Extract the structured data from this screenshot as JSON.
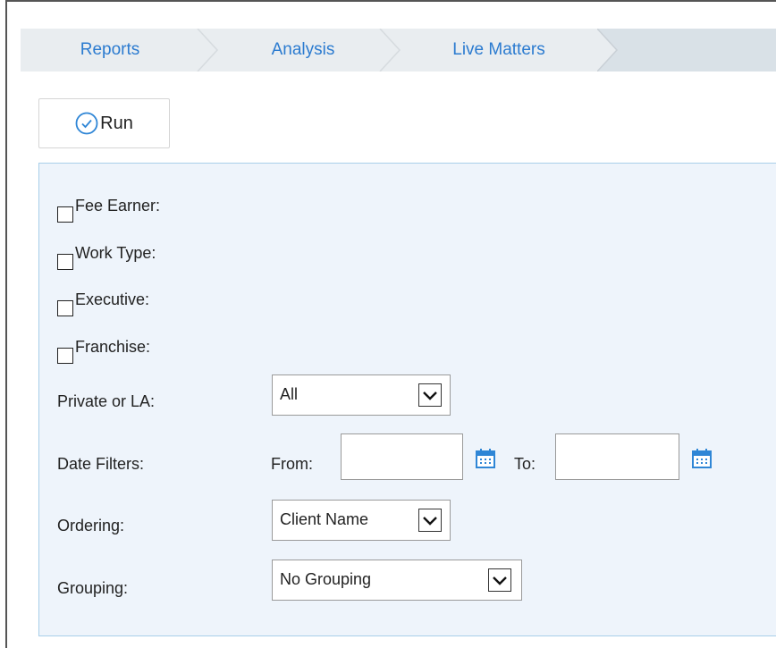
{
  "breadcrumb": {
    "items": [
      {
        "label": "Reports"
      },
      {
        "label": "Analysis"
      },
      {
        "label": "Live Matters"
      }
    ]
  },
  "toolbar": {
    "run_label": "Run",
    "run_icon": "check-circle-icon"
  },
  "filters": {
    "checkboxes": [
      {
        "label": "Fee Earner:",
        "checked": false
      },
      {
        "label": "Work Type:",
        "checked": false
      },
      {
        "label": "Executive:",
        "checked": false
      },
      {
        "label": "Franchise:",
        "checked": false
      }
    ],
    "private_or_la": {
      "label": "Private or LA:",
      "value": "All"
    },
    "date_filters": {
      "label": "Date Filters:",
      "from_label": "From:",
      "from_value": "",
      "to_label": "To:",
      "to_value": "",
      "calendar_icon": "calendar-icon"
    },
    "ordering": {
      "label": "Ordering:",
      "value": "Client Name"
    },
    "grouping": {
      "label": "Grouping:",
      "value": "No Grouping"
    }
  },
  "colors": {
    "link": "#2b7bd0",
    "breadcrumb_bg": "#e9edf0",
    "panel_bg": "#eef4fb",
    "panel_border": "#a9cfe9",
    "calendar": "#2f86d6"
  }
}
